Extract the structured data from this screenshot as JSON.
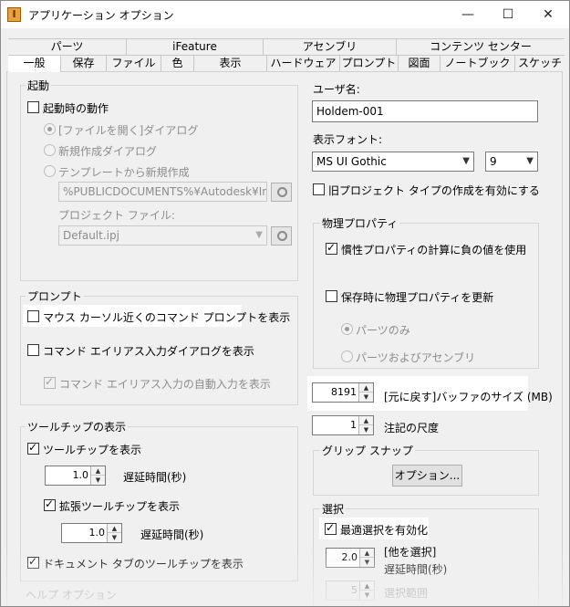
{
  "window": {
    "title": "アプリケーション オプション",
    "icon_letter": "I",
    "minimize_glyph": "—",
    "maximize_glyph": "☐",
    "close_glyph": "✕"
  },
  "tabs": {
    "row1": [
      "パーツ",
      "iFeature",
      "アセンブリ",
      "コンテンツ センター"
    ],
    "row2": [
      "一般",
      "保存",
      "ファイル",
      "色",
      "表示",
      "ハードウェア",
      "プロンプト",
      "図面",
      "ノートブック",
      "スケッチ"
    ]
  },
  "startup": {
    "legend": "起動",
    "action_label": "起動時の動作",
    "open_file_dialog": "[ファイルを開く]ダイアログ",
    "new_file_dialog": "新規作成ダイアログ",
    "from_template": "テンプレートから新規作成",
    "template_path": "%PUBLICDOCUMENTS%¥Autodesk¥Inventor",
    "project_file_label": "プロジェクト ファイル:",
    "project_file_value": "Default.ipj"
  },
  "prompt": {
    "legend": "プロンプト",
    "near_cursor": "マウス カーソル近くのコマンド プロンプトを表示",
    "command_alias_dialog": "コマンド エイリアス入力ダイアログを表示",
    "auto_complete": "コマンド エイリアス入力の自動入力を表示"
  },
  "tooltips": {
    "legend": "ツールチップの表示",
    "show": "ツールチップを表示",
    "delay_value": "1.0",
    "delay_label": "遅延時間(秒)",
    "extended": "拡張ツールチップを表示",
    "ext_delay_value": "1.0",
    "ext_delay_label": "遅延時間(秒)",
    "doc_tabs": "ドキュメント タブのツールチップを表示"
  },
  "help_legend": "ヘルプ オプション",
  "user": {
    "name_label": "ユーザ名:",
    "name_value": "Holdem-001",
    "font_label": "表示フォント:",
    "font_value": "MS UI Gothic",
    "font_size": "9",
    "legacy_project": "旧プロジェクト タイプの作成を有効にする"
  },
  "physical": {
    "legend": "物理プロパティ",
    "inertia_negative": "慣性プロパティの計算に負の値を使用",
    "update_on_save": "保存時に物理プロパティを更新",
    "parts_only": "パーツのみ",
    "parts_and_assemblies": "パーツおよびアセンブリ"
  },
  "undo": {
    "value": "8191",
    "label": "[元に戻す]バッファのサイズ (MB)"
  },
  "annotation": {
    "value": "1",
    "label": "注記の尺度"
  },
  "grip": {
    "legend": "グリップ スナップ",
    "button": "オプション..."
  },
  "selection": {
    "legend": "選択",
    "optimized": "最適選択を有効化",
    "select_other_value": "2.0",
    "select_other_label": "[他を選択]",
    "select_other_delay": "遅延時間(秒)",
    "range_value": "5",
    "range_label": "選択範囲"
  }
}
